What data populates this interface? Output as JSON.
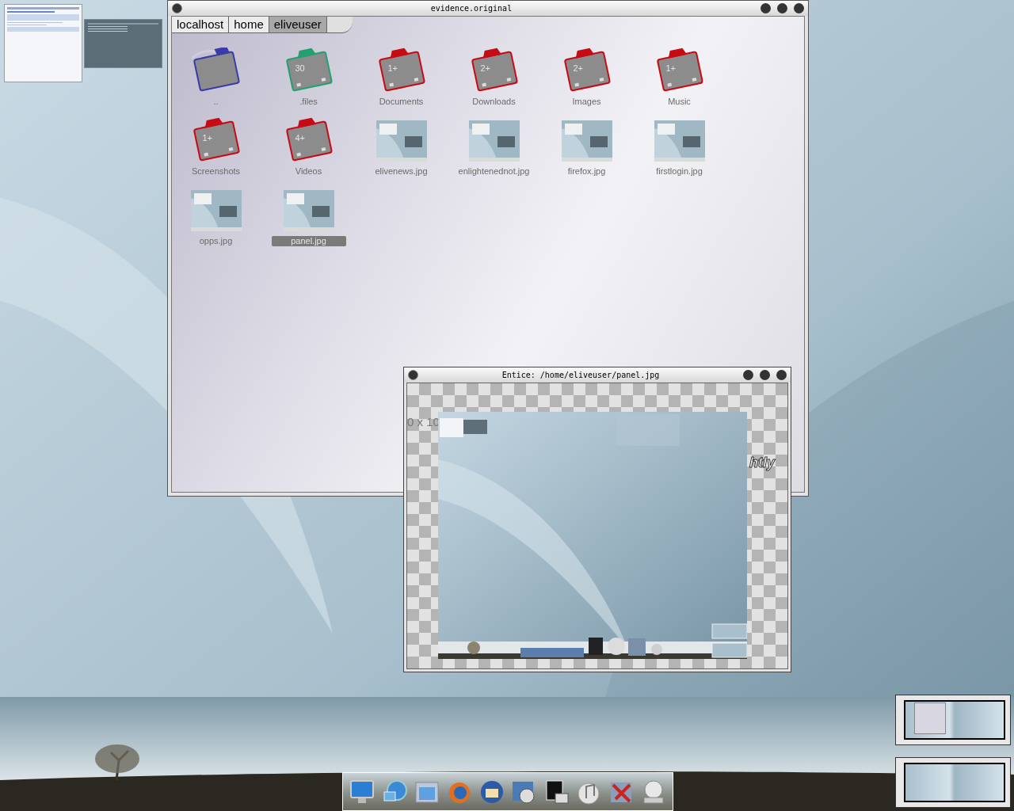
{
  "file_manager": {
    "title": "evidence.original",
    "breadcrumbs": [
      {
        "label": "localhost",
        "selected": false
      },
      {
        "label": "home",
        "selected": false
      },
      {
        "label": "eliveuser",
        "selected": true
      }
    ],
    "items": [
      {
        "kind": "parent",
        "label": "..",
        "color": "#3a3aa8",
        "selected": false
      },
      {
        "kind": "folder",
        "label": ".files",
        "badge": "30",
        "color": "#22a070",
        "selected": false
      },
      {
        "kind": "folder",
        "label": "Documents",
        "badge": "1+",
        "color": "#c80a14",
        "selected": false
      },
      {
        "kind": "folder",
        "label": "Downloads",
        "badge": "2+",
        "color": "#c80a14",
        "selected": false
      },
      {
        "kind": "folder",
        "label": "Images",
        "badge": "2+",
        "color": "#c80a14",
        "selected": false
      },
      {
        "kind": "folder",
        "label": "Music",
        "badge": "1+",
        "color": "#c80a14",
        "selected": false
      },
      {
        "kind": "folder",
        "label": "Screenshots",
        "badge": "1+",
        "color": "#c80a14",
        "selected": false
      },
      {
        "kind": "folder",
        "label": "Videos",
        "badge": "4+",
        "color": "#c80a14",
        "selected": false
      },
      {
        "label": "elivenews.jpg",
        "selected": false
      },
      {
        "label": "enlightenednot.jpg",
        "selected": false
      },
      {
        "label": "firefox.jpg",
        "selected": false
      },
      {
        "label": "firstlogin.jpg",
        "selected": false
      },
      {
        "label": "opps.jpg",
        "selected": false
      },
      {
        "label": "panel.jpg",
        "selected": true
      }
    ]
  },
  "viewer": {
    "title": "Entice: /home/eliveuser/panel.jpg",
    "size_fragment": "0 x 10",
    "caption_fragment": "htly"
  }
}
